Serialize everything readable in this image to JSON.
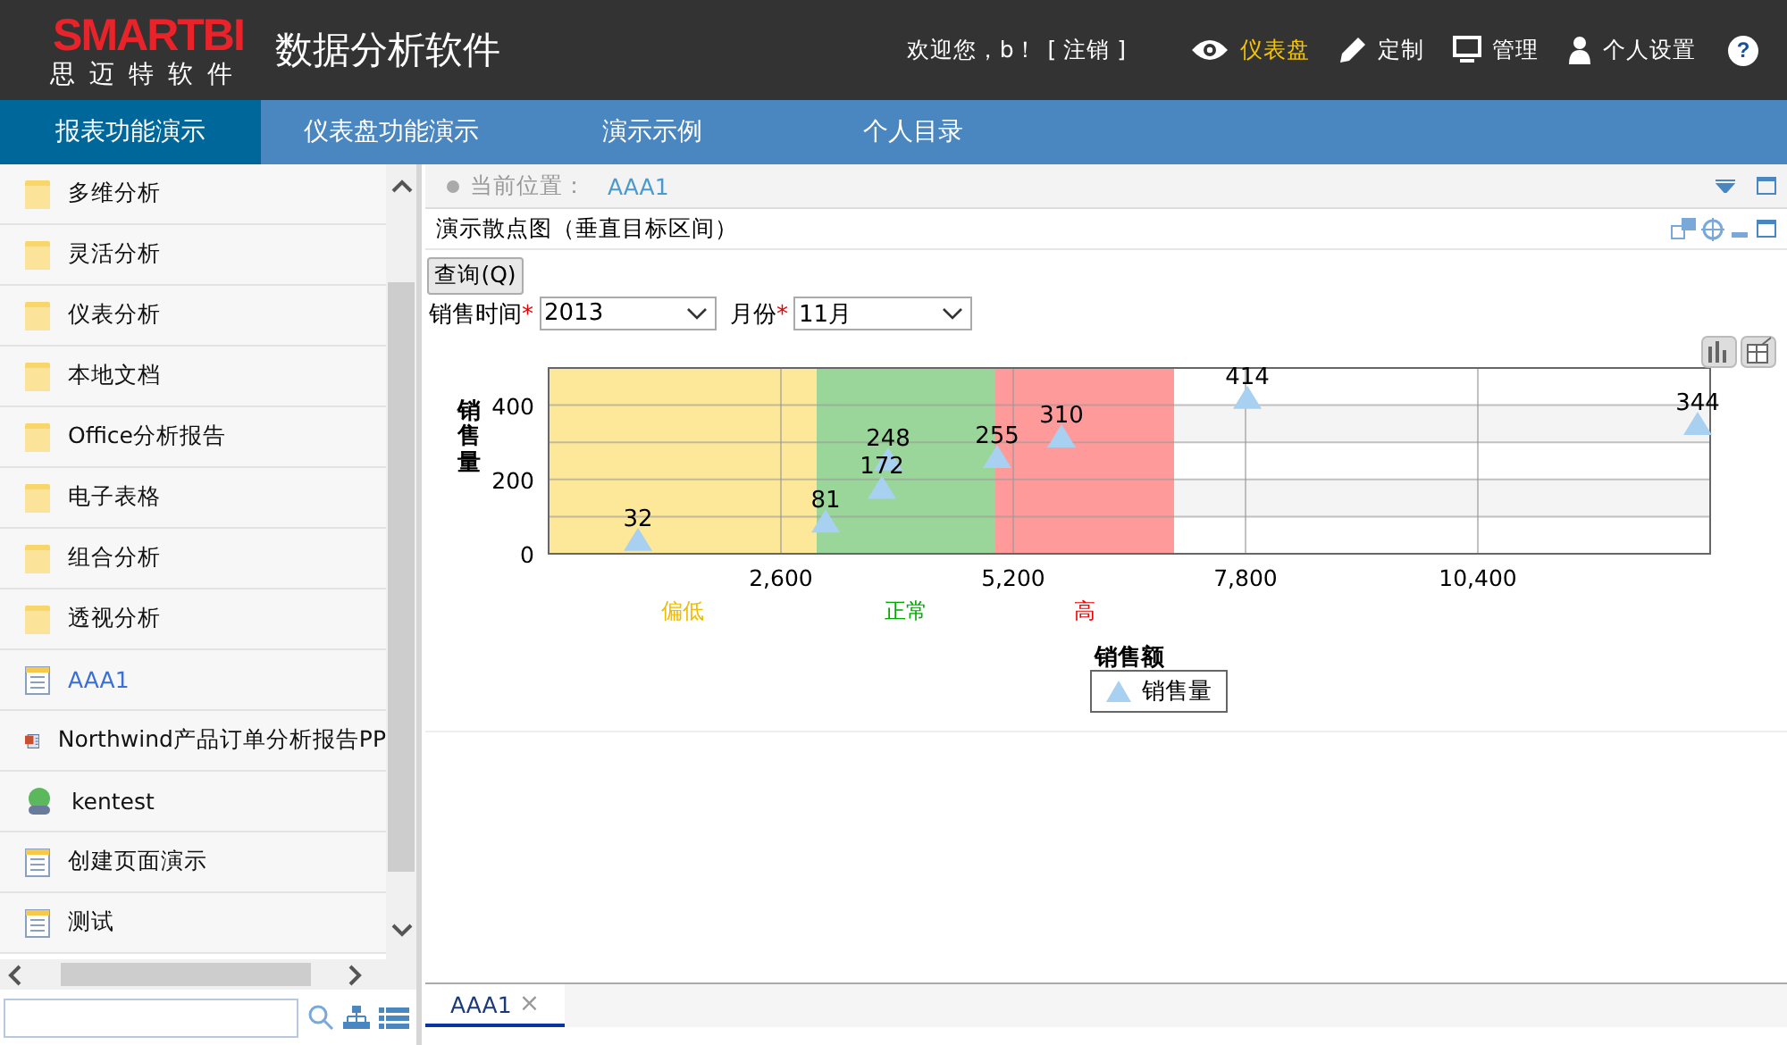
{
  "header": {
    "logo_text": "SMARTBI",
    "logo_subtitle": "思迈特软件",
    "app_title": "数据分析软件",
    "welcome": "欢迎您，b！",
    "logout": "[ 注销 ]",
    "actions": [
      {
        "kind": "eye",
        "label": "仪表盘",
        "selected": true
      },
      {
        "kind": "pencil",
        "label": "定制",
        "selected": false
      },
      {
        "kind": "monitor",
        "label": "管理",
        "selected": false
      },
      {
        "kind": "user",
        "label": "个人设置",
        "selected": false
      }
    ],
    "help": "?"
  },
  "nav": [
    {
      "label": "报表功能演示",
      "selected": true
    },
    {
      "label": "仪表盘功能演示",
      "selected": false
    },
    {
      "label": "演示示例",
      "selected": false
    },
    {
      "label": "个人目录",
      "selected": false
    }
  ],
  "sidebar": {
    "items": [
      {
        "kind": "folder",
        "label": "多维分析",
        "selected": false
      },
      {
        "kind": "folder",
        "label": "灵活分析",
        "selected": false
      },
      {
        "kind": "folder",
        "label": "仪表分析",
        "selected": false
      },
      {
        "kind": "folder",
        "label": "本地文档",
        "selected": false
      },
      {
        "kind": "folder",
        "label": "Office分析报告",
        "selected": false
      },
      {
        "kind": "folder",
        "label": "电子表格",
        "selected": false
      },
      {
        "kind": "folder",
        "label": "组合分析",
        "selected": false
      },
      {
        "kind": "folder",
        "label": "透视分析",
        "selected": false
      },
      {
        "kind": "report",
        "label": "AAA1",
        "selected": true
      },
      {
        "kind": "ppt",
        "label": "Northwind产品订单分析报告PP",
        "selected": false
      },
      {
        "kind": "link",
        "label": "kentest",
        "selected": false
      },
      {
        "kind": "report",
        "label": "创建页面演示",
        "selected": false
      },
      {
        "kind": "report",
        "label": "测试",
        "selected": false
      }
    ]
  },
  "breadcrumb": {
    "label": "当前位置：",
    "value": "AAA1"
  },
  "report": {
    "title": "演示散点图（垂直目标区间）",
    "query_button": "查询(Q)",
    "filters": [
      {
        "label": "销售时间",
        "required_mark": "*",
        "value": "2013"
      },
      {
        "label": "月份",
        "required_mark": "*",
        "value": "11月"
      }
    ],
    "chart_data": {
      "type": "scatter",
      "xlabel": "销售额",
      "ylabel": "销售量",
      "xlim": [
        0,
        13000
      ],
      "ylim": [
        0,
        500
      ],
      "xticks": [
        {
          "value": 2600,
          "label": "2,600"
        },
        {
          "value": 5200,
          "label": "5,200"
        },
        {
          "value": 7800,
          "label": "7,800"
        },
        {
          "value": 10400,
          "label": "10,400"
        }
      ],
      "yticks": [
        0,
        200,
        400
      ],
      "data_labels": true,
      "grid": true,
      "x": [
        1000,
        3100,
        3730,
        3800,
        5020,
        5740,
        7820,
        12860
      ],
      "series": [
        {
          "name": "销售量",
          "color": "#a8d0f0",
          "values": [
            32,
            81,
            172,
            248,
            255,
            310,
            414,
            344
          ]
        }
      ],
      "bands": [
        {
          "axis": "x",
          "from": 0,
          "to": 3000,
          "label": "偏低",
          "color": "#fde89a"
        },
        {
          "axis": "x",
          "from": 3000,
          "to": 5000,
          "label": "正常",
          "color": "#9ad69a"
        },
        {
          "axis": "x",
          "from": 5000,
          "to": 7000,
          "label": "高",
          "color": "#ff9a9a"
        }
      ]
    }
  },
  "bottom_tabs": [
    {
      "label": "AAA1",
      "close": "×",
      "selected": true
    }
  ]
}
